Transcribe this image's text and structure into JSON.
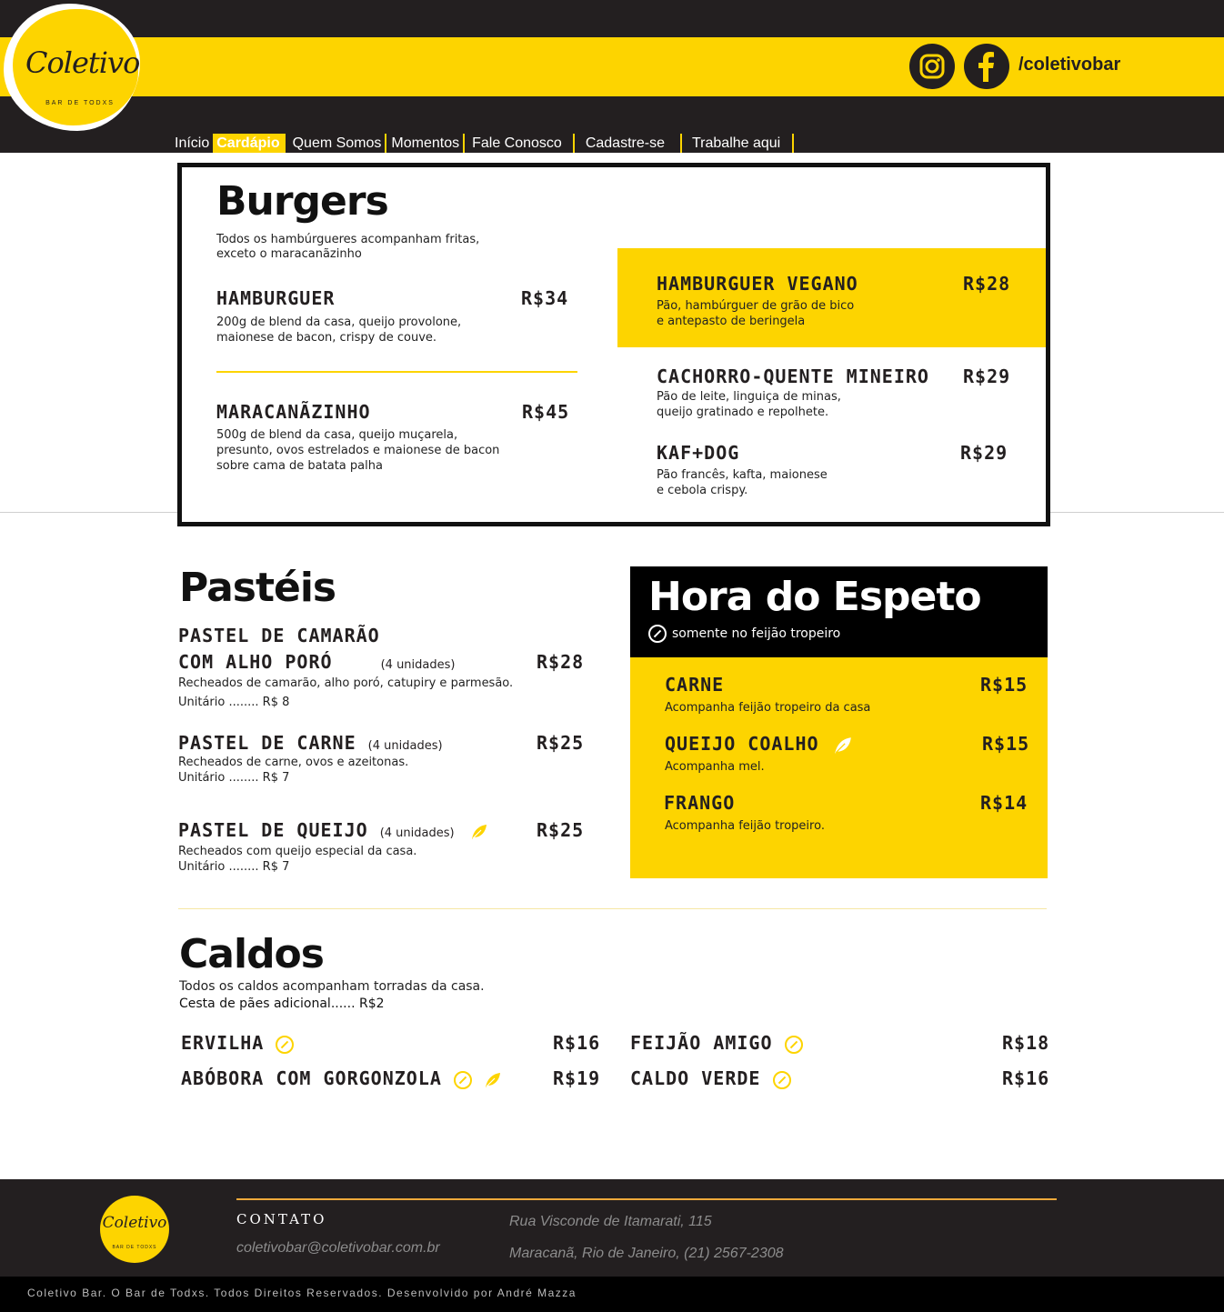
{
  "header": {
    "logo_script": "Coletivo",
    "logo_sub": "BAR DE TODXS",
    "social_handle": "/coletivobar",
    "icons": [
      "instagram-icon",
      "facebook-icon"
    ],
    "colors": {
      "brand_yellow": "#fdd400",
      "dark": "#231f20"
    }
  },
  "nav": {
    "items": [
      "Início",
      "Cardápio",
      "Quem Somos",
      "Momentos",
      "Fale Conosco",
      "Cadastre-se",
      "Trabalhe aqui"
    ],
    "active": "Cardápio"
  },
  "burgers": {
    "title": "Burgers",
    "note_line1": "Todos os hambúrgueres acompanham fritas,",
    "note_line2": "exceto o maracanãzinho",
    "items": [
      {
        "name": "HAMBURGUER",
        "price": "R$34",
        "desc1": "200g de blend da casa, queijo provolone,",
        "desc2": "maionese de bacon, crispy de couve.",
        "desc3": ""
      },
      {
        "name": "MARACANÃZINHO",
        "price": "R$45",
        "desc1": "500g de blend da casa, queijo muçarela,",
        "desc2": "presunto, ovos estrelados e maionese de bacon",
        "desc3": "sobre cama de batata palha"
      },
      {
        "name": "HAMBURGUER VEGANO",
        "price": "R$28",
        "desc1": "Pão, hambúrguer de grão de bico",
        "desc2": "e antepasto de beringela",
        "desc3": ""
      },
      {
        "name": "CACHORRO-QUENTE MINEIRO",
        "price": "R$29",
        "desc1": "Pão de leite, linguiça de minas,",
        "desc2": "queijo gratinado e repolhete.",
        "desc3": ""
      },
      {
        "name": "KAF+DOG",
        "price": "R$29",
        "desc1": "Pão francês, kafta, maionese",
        "desc2": "e cebola crispy.",
        "desc3": ""
      }
    ]
  },
  "pasteis": {
    "title": "Pastéis",
    "items": [
      {
        "name_line1": "PASTEL DE CAMARÃO",
        "name_line2": "COM ALHO PORÓ",
        "qty": "(4 unidades)",
        "price": "R$28",
        "desc": "Recheados de camarão,  alho poró, catupiry e parmesão.",
        "unit": "Unitário ........ R$ 8"
      },
      {
        "name_line1": "PASTEL DE CARNE",
        "name_line2": "",
        "qty": "(4 unidades)",
        "price": "R$25",
        "desc": "Recheados de carne, ovos e azeitonas.",
        "unit": "Unitário ........ R$ 7"
      },
      {
        "name_line1": "PASTEL DE QUEIJO",
        "name_line2": "",
        "qty": "(4 unidades)",
        "price": "R$25",
        "desc": "Recheados com queijo especial da casa.",
        "unit": "Unitário ........ R$ 7"
      }
    ]
  },
  "espeto": {
    "title": "Hora do Espeto",
    "subtitle": "somente no feijão tropeiro",
    "items": [
      {
        "name": "CARNE",
        "price": "R$15",
        "desc": "Acompanha feijão tropeiro da casa"
      },
      {
        "name": "QUEIJO COALHO",
        "price": "R$15",
        "desc": "Acompanha mel."
      },
      {
        "name": "FRANGO",
        "price": "R$14",
        "desc": "Acompanha feijão tropeiro."
      }
    ]
  },
  "caldos": {
    "title": "Caldos",
    "note": "Todos os caldos acompanham torradas da casa.",
    "note2": "Cesta de pães adicional...... R$2",
    "items": [
      {
        "name": "ERVILHA",
        "price": "R$16"
      },
      {
        "name": "ABÓBORA COM GORGONZOLA",
        "price": "R$19"
      },
      {
        "name": "FEIJÃO AMIGO",
        "price": "R$18"
      },
      {
        "name": "CALDO VERDE",
        "price": "R$16"
      }
    ]
  },
  "footer": {
    "logo_script": "Coletivo",
    "logo_sub": "BAR DE TODXS",
    "contato_label": "CONTATO",
    "email": "coletivobar@coletivobar.com.br",
    "address1": "Rua Visconde de Itamarati, 115",
    "address2": "Maracanã, Rio de Janeiro, (21) 2567-2308",
    "copyright": "Coletivo Bar. O Bar de Todxs. Todos Direitos Reservados. Desenvolvido por André Mazza"
  }
}
